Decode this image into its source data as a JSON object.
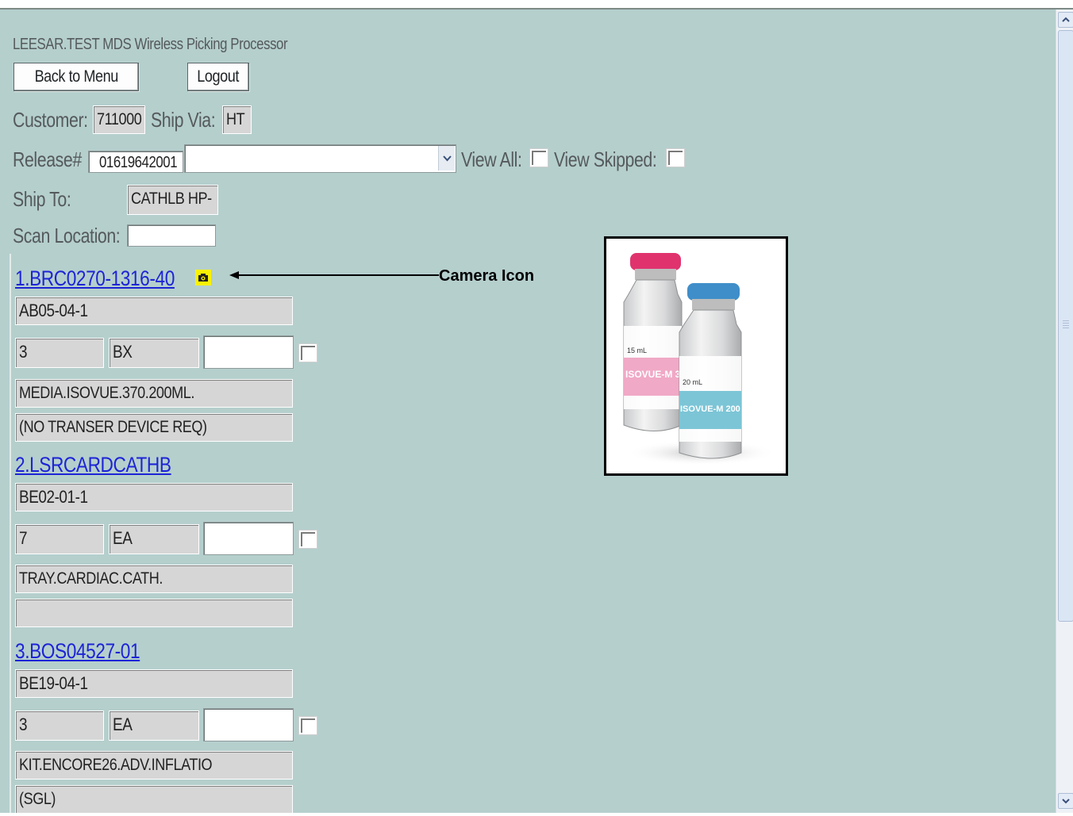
{
  "app": {
    "title": "LEESAR.TEST MDS Wireless Picking Processor"
  },
  "buttons": {
    "back": "Back to Menu",
    "logout": "Logout"
  },
  "order": {
    "customer_label": "Customer:",
    "customer": "711000",
    "shipvia_label": "Ship Via:",
    "shipvia": "HT",
    "release_label": "Release#",
    "release": "01619642001",
    "release_select": "",
    "viewall_label": "View All:",
    "viewskipped_label": "View Skipped:",
    "shipto_label": "Ship To:",
    "shipto": "CATHLB HP-",
    "scanloc_label": "Scan Location:",
    "scanloc": ""
  },
  "items": [
    {
      "link": "1.BRC0270-1316-40",
      "location": "AB05-04-1",
      "qty": "3",
      "uom": "BX",
      "desc1": "MEDIA.ISOVUE.370.200ML.",
      "desc2": "(NO TRANSER DEVICE REQ)"
    },
    {
      "link": "2.LSRCARDCATHB",
      "location": "BE02-01-1",
      "qty": "7",
      "uom": "EA",
      "desc1": "TRAY.CARDIAC.CATH.",
      "desc2": ""
    },
    {
      "link": "3.BOS04527-01",
      "location": "BE19-04-1",
      "qty": "3",
      "uom": "EA",
      "desc1": "KIT.ENCORE26.ADV.INFLATIO",
      "desc2": "(SGL)"
    }
  ],
  "annotation": {
    "label": "Camera Icon"
  },
  "product_image": {
    "vial1_brand": "ISOVUE-M 3",
    "vial1_volume": "15 mL",
    "vial2_brand": "ISOVUE-M 200",
    "vial2_volume": "20 mL",
    "vial1_cap_color": "#e0336e",
    "vial2_cap_color": "#3f8ec9"
  },
  "colors": {
    "page_bg": "#b5cfcd",
    "link": "#1d24d6",
    "field_bg": "#d6d6d6"
  }
}
